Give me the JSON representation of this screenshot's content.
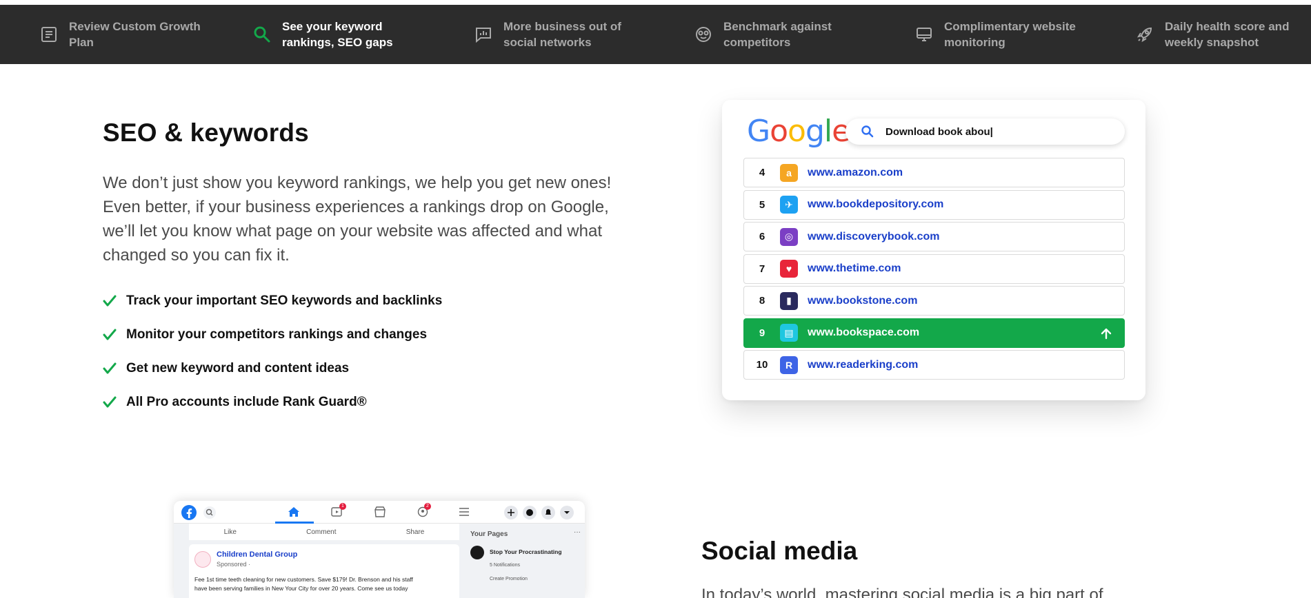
{
  "topnav": {
    "items": [
      {
        "label": "Review Custom Growth Plan",
        "icon": "document-list-icon",
        "active": false
      },
      {
        "label": "See your keyword rankings, SEO gaps",
        "icon": "search-icon",
        "active": true
      },
      {
        "label": "More business out of social networks",
        "icon": "bar-chart-icon",
        "active": false
      },
      {
        "label": "Benchmark against competitors",
        "icon": "glasses-face-icon",
        "active": false
      },
      {
        "label": "Complimentary website monitoring",
        "icon": "monitor-icon",
        "active": false
      },
      {
        "label": "Daily health score and weekly snapshot",
        "icon": "rocket-icon",
        "active": false
      }
    ]
  },
  "seo": {
    "title": "SEO & keywords",
    "description": "We don’t just show you keyword rankings, we help you get new ones! Even better, if your business experiences a rankings drop on Google, we’ll let you know what page on your website was affected and what changed so you can fix it.",
    "checklist": [
      "Track your important SEO keywords and backlinks",
      "Monitor your competitors rankings and changes",
      "Get new keyword and content ideas",
      "All Pro accounts include Rank Guard®"
    ]
  },
  "google_card": {
    "logo_letters": [
      "G",
      "o",
      "o",
      "g",
      "l",
      "e"
    ],
    "logo_colors": [
      "#4285F4",
      "#EA4335",
      "#FBBC05",
      "#4285F4",
      "#34A853",
      "#EA4335"
    ],
    "query": "Download book abou|",
    "results": [
      {
        "rank": "4",
        "url": "www.amazon.com",
        "fav": "a",
        "color": "#f5a623",
        "highlight": false
      },
      {
        "rank": "5",
        "url": "www.bookdepository.com",
        "fav": "✈",
        "color": "#1da1f2",
        "highlight": false
      },
      {
        "rank": "6",
        "url": "www.discoverybook.com",
        "fav": "◎",
        "color": "#7b3fc4",
        "highlight": false
      },
      {
        "rank": "7",
        "url": "www.thetime.com",
        "fav": "♥",
        "color": "#e8253a",
        "highlight": false
      },
      {
        "rank": "8",
        "url": "www.bookstone.com",
        "fav": "▮",
        "color": "#2a2a5e",
        "highlight": false
      },
      {
        "rank": "9",
        "url": "www.bookspace.com",
        "fav": "▤",
        "color": "#1fc7e0",
        "highlight": true
      },
      {
        "rank": "10",
        "url": "www.readerking.com",
        "fav": "R",
        "color": "#3e64e6",
        "highlight": false
      }
    ]
  },
  "social": {
    "title": "Social media",
    "description": "In today’s world, mastering social media is a big part of",
    "fb": {
      "actions": [
        "Like",
        "Comment",
        "Share"
      ],
      "badge_video": "1",
      "badge_groups": "2",
      "sidebar_title": "Your Pages",
      "sidebar_page": "Stop Your Procrastinating",
      "sidebar_notifications": "5 Notifications",
      "sidebar_promo": "Create Promotion",
      "post_author": "Children Dental Group",
      "post_sponsored": "Sponsored ·",
      "post_text_1": "Fee 1st time teeth cleaning for new customers. Save $179! Dr. Brenson and his staff",
      "post_text_2": "have been serving families in New Your City for over 20 years. Come see us today"
    }
  },
  "colors": {
    "accent_green": "#13a84a",
    "nav_bg": "#2c2c2c",
    "link_blue": "#1a3fc9"
  }
}
